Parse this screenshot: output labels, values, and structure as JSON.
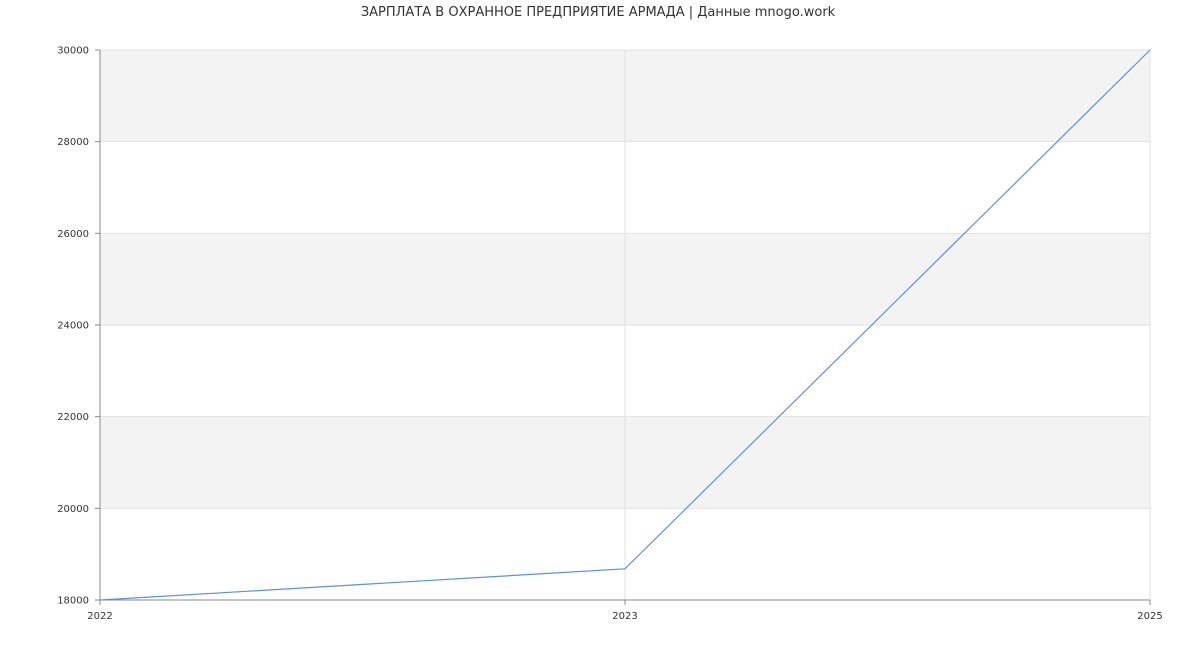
{
  "chart_data": {
    "type": "line",
    "title": "ЗАРПЛАТА В ОХРАННОЕ ПРЕДПРИЯТИЕ АРМАДА | Данные mnogo.work",
    "xlabel": "",
    "ylabel": "",
    "x": [
      "2022",
      "2023",
      "2025"
    ],
    "x_positions": [
      0,
      0.5,
      1
    ],
    "series": [
      {
        "values": [
          18000,
          18680,
          30000
        ]
      }
    ],
    "ylim": [
      18000,
      30000
    ],
    "y_ticks": [
      18000,
      20000,
      22000,
      24000,
      26000,
      28000,
      30000
    ],
    "x_ticks": [
      "2022",
      "2023",
      "2025"
    ],
    "grid": true,
    "banded_background": true,
    "colors": {
      "line": "#5b8fe0",
      "band": "#f3f3f3",
      "grid": "#e2e2e2",
      "axis": "#888888",
      "text": "#333333"
    }
  }
}
